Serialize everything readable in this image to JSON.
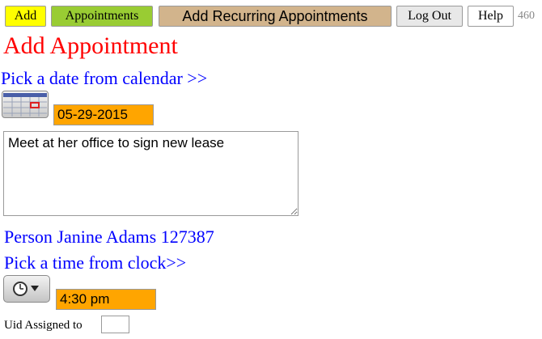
{
  "toolbar": {
    "add": "Add",
    "appointments": "Appointments",
    "add_recurring": "Add Recurring Appointments",
    "logout": "Log Out",
    "help": "Help",
    "counter": "460"
  },
  "page": {
    "title": "Add Appointment",
    "pick_date_link": "Pick a date from calendar >>",
    "date_value": "05-29-2015",
    "notes_value": "Meet at her office to sign new lease",
    "person_text": "Person Janine Adams 127387",
    "pick_time_link": "Pick a time from clock>>",
    "time_value": "4:30 pm",
    "uid_label": "Uid Assigned to",
    "uid_value": ""
  },
  "icons": {
    "calendar": "calendar-icon",
    "clock": "clock-icon"
  },
  "colors": {
    "add_button": "#ffff00",
    "appointments_button": "#99cc33",
    "recurring_button": "#d2b48c",
    "title": "#ff0000",
    "links": "#0000ff",
    "input_highlight": "#ffa500"
  }
}
